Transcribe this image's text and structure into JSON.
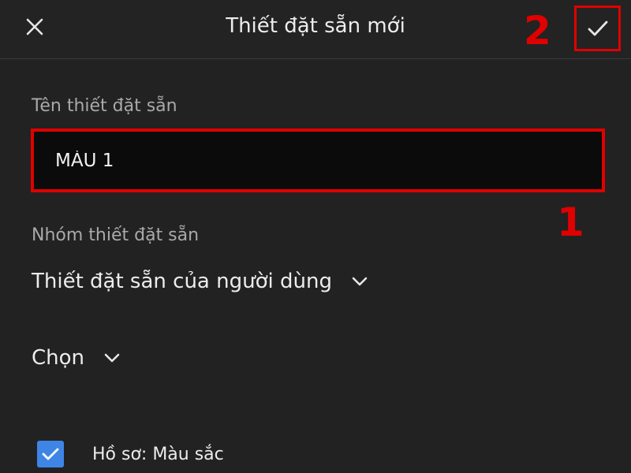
{
  "header": {
    "title": "Thiết đặt sẵn mới",
    "close_icon": "close-icon",
    "confirm_icon": "checkmark-icon"
  },
  "annotations": {
    "marker_1": "1",
    "marker_2": "2",
    "color": "#e00000"
  },
  "form": {
    "name_label": "Tên thiết đặt sẵn",
    "name_value": "MÀU 1",
    "group_label": "Nhóm thiết đặt sẵn",
    "group_value": "Thiết đặt sẵn của người dùng",
    "choose_label": "Chọn",
    "profile_checkbox": {
      "label": "Hồ sơ: Màu sắc",
      "checked": true
    }
  },
  "colors": {
    "background": "#222222",
    "input_background": "#0b0b0b",
    "checkbox_accent": "#3e85e6"
  }
}
